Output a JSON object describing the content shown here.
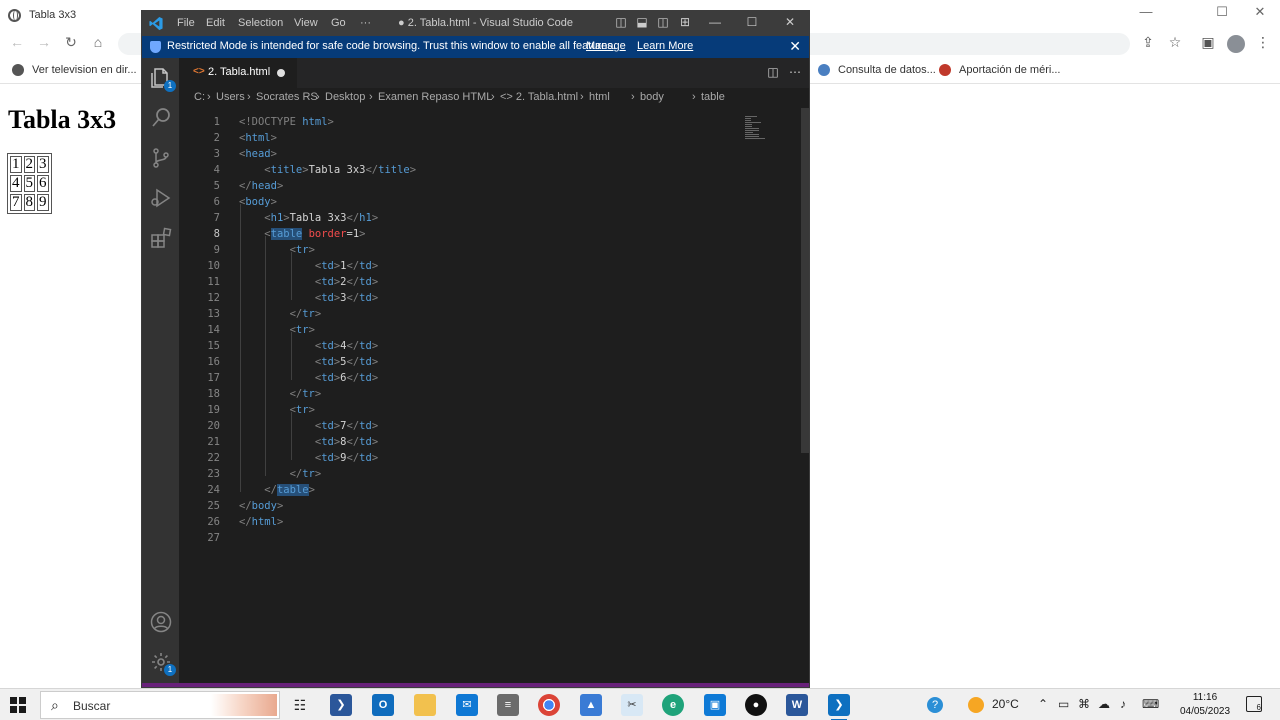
{
  "browser": {
    "tab_title": "Tabla 3x3",
    "bookmarks": [
      {
        "label": "Ver television en dir..."
      },
      {
        "label": "Consulta de datos..."
      },
      {
        "label": "Aportación de méri..."
      }
    ],
    "page": {
      "heading": "Tabla 3x3",
      "table": [
        [
          "1",
          "2",
          "3"
        ],
        [
          "4",
          "5",
          "6"
        ],
        [
          "7",
          "8",
          "9"
        ]
      ]
    }
  },
  "vscode": {
    "menu": [
      "File",
      "Edit",
      "Selection",
      "View",
      "Go",
      "···"
    ],
    "window_title": "● 2. Tabla.html - Visual Studio Code",
    "banner": {
      "message": "Restricted Mode is intended for safe code browsing. Trust this window to enable all features.",
      "manage": "Manage",
      "learn_more": "Learn More"
    },
    "badge_explorer": "1",
    "badge_settings": "1",
    "tab": {
      "icon": "<>",
      "label": "2. Tabla.html"
    },
    "breadcrumb": [
      "C:",
      "Users",
      "Socrates RS",
      "Desktop",
      "Examen Repaso HTML",
      "<> 2. Tabla.html",
      "html",
      "body",
      "table"
    ],
    "code": [
      "1",
      "2",
      "3",
      "4",
      "5",
      "6",
      "7",
      "8",
      "9",
      "10",
      "11",
      "12",
      "13",
      "14",
      "15",
      "16",
      "17",
      "18",
      "19",
      "20",
      "21",
      "22",
      "23",
      "24",
      "25",
      "26",
      "27"
    ],
    "tokens": {
      "doctype": "<!DOCTYPE",
      "html_kw": "html",
      "gt": ">",
      "lt": "<",
      "lt_slash": "</",
      "t_html": "html",
      "t_head": "head",
      "t_title": "title",
      "t_body": "body",
      "t_h1": "h1",
      "t_table": "table",
      "t_tr": "tr",
      "t_td": "td",
      "title_text": "Tabla 3x3",
      "h1_text": "Tabla 3x3",
      "attr_border": "border",
      "attr_eq": "=1",
      "cells": [
        "1",
        "2",
        "3",
        "4",
        "5",
        "6",
        "7",
        "8",
        "9"
      ]
    }
  },
  "taskbar": {
    "search_placeholder": "Buscar",
    "weather": "20°C",
    "time": "11:16",
    "date": "04/05/2023",
    "notifications": "6"
  }
}
